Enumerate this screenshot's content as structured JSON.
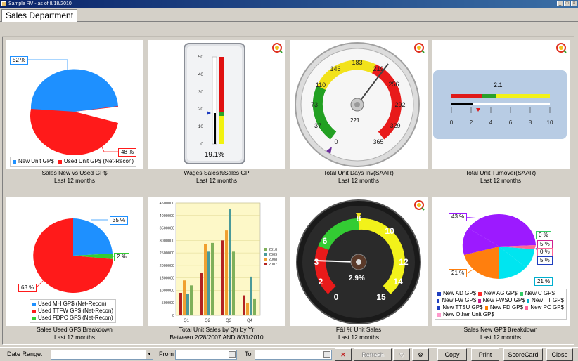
{
  "window": {
    "title": "Sample RV - as of 8/18/2010"
  },
  "tabs": [
    {
      "label": "Sales Department"
    }
  ],
  "tiles": [
    {
      "caption1": "Sales New vs Used GP$",
      "caption2": "Last 12 months"
    },
    {
      "caption1": "Wages Sales%Sales GP",
      "caption2": "Last 12 months"
    },
    {
      "caption1": "Total Unit Days Inv(SAAR)",
      "caption2": "Last 12 months"
    },
    {
      "caption1": "Total Unit Turnover(SAAR)",
      "caption2": "Last 12 months"
    },
    {
      "caption1": "Sales Used GP$ Breakdown",
      "caption2": "Last 12 months"
    },
    {
      "caption1": "Total Unit Sales by Qtr by Yr",
      "caption2": "Between 2/28/2007 AND 8/31/2010"
    },
    {
      "caption1": "F&I % Unit Sales",
      "caption2": "Last 12 months"
    },
    {
      "caption1": "Sales New GP$ Breakdown",
      "caption2": "Last 12 months"
    }
  ],
  "pie_new_used": {
    "label_top": "52 %",
    "label_bottom": "48 %",
    "legend": [
      "New Unit GP$",
      "Used Unit GP$ (Net-Recon)"
    ],
    "colors": [
      "#1e90ff",
      "#ff1a1a"
    ],
    "values": [
      52,
      48
    ]
  },
  "wages_gauge": {
    "ticks": [
      "50",
      "40",
      "30",
      "20",
      "10",
      "0"
    ],
    "value_text": "19.1%",
    "value": 19.1
  },
  "days_inv_gauge": {
    "ticks": [
      "0",
      "37",
      "73",
      "110",
      "146",
      "183",
      "219",
      "256",
      "292",
      "329",
      "365"
    ],
    "center_value": "221"
  },
  "turnover_gauge": {
    "value_text": "2.1",
    "value": 2.1,
    "ticks": [
      "0",
      "2",
      "4",
      "6",
      "8",
      "10"
    ]
  },
  "pie_used_breakdown": {
    "label_top": "35 %",
    "label_right": "2 %",
    "label_bottom": "63 %",
    "legend": [
      "Used MH GP$ (Net-Recon)",
      "Used TTFW GP$ (Net-Recon)",
      "Used FDPC GP$ (Net-Recon)"
    ],
    "colors": [
      "#1e90ff",
      "#ff1a1a",
      "#33cc33"
    ],
    "values": [
      35,
      63,
      2
    ]
  },
  "chart_data": {
    "type": "bar",
    "categories": [
      "Q1",
      "Q2",
      "Q3",
      "Q4"
    ],
    "ylim": [
      0,
      4500000
    ],
    "yticks": [
      "0",
      "500000",
      "1000000",
      "1500000",
      "2000000",
      "2500000",
      "3000000",
      "3500000",
      "4000000",
      "4500000"
    ],
    "series": [
      {
        "name": "2007",
        "color": "#b22222",
        "values": [
          900000,
          1700000,
          3000000,
          800000
        ]
      },
      {
        "name": "2008",
        "color": "#f0a030",
        "values": [
          1400000,
          2850000,
          3400000,
          500000
        ]
      },
      {
        "name": "2009",
        "color": "#4a9a9a",
        "values": [
          850000,
          2550000,
          4250000,
          1550000
        ]
      },
      {
        "name": "2010",
        "color": "#7fb05a",
        "values": [
          1200000,
          2900000,
          2550000,
          650000
        ]
      }
    ],
    "legend_order": [
      "2010",
      "2009",
      "2008",
      "2007"
    ]
  },
  "fi_gauge": {
    "ticks": [
      "0",
      "2",
      "3",
      "6",
      "8",
      "10",
      "12",
      "14",
      "15"
    ],
    "value_text": "2.9%"
  },
  "pie_new_breakdown": {
    "labels": [
      "43 %",
      "0 %",
      "5 %",
      "0 %",
      "5 %",
      "21 %",
      "21 %"
    ],
    "legend": [
      "New AD GP$",
      "New AG GP$",
      "New C GP$",
      "New FW GP$",
      "New FWSU GP$",
      "New TT GP$",
      "New TTSU GP$",
      "New FD GP$",
      "New PC GP$",
      "New Other Unit GP$"
    ],
    "colors": [
      "#1f3fbf",
      "#ff2a2a",
      "#33cc66",
      "#1f3fbf",
      "#d02090",
      "#00b0d0",
      "#1f3fbf",
      "#ff7f00",
      "#ff6699",
      "#ff99cc"
    ]
  },
  "bottom": {
    "date_range_label": "Date Range:",
    "from_label": "From",
    "to_label": "To",
    "refresh": "Refresh",
    "copy": "Copy",
    "print": "Print",
    "scorecard": "ScoreCard",
    "close": "Close"
  }
}
